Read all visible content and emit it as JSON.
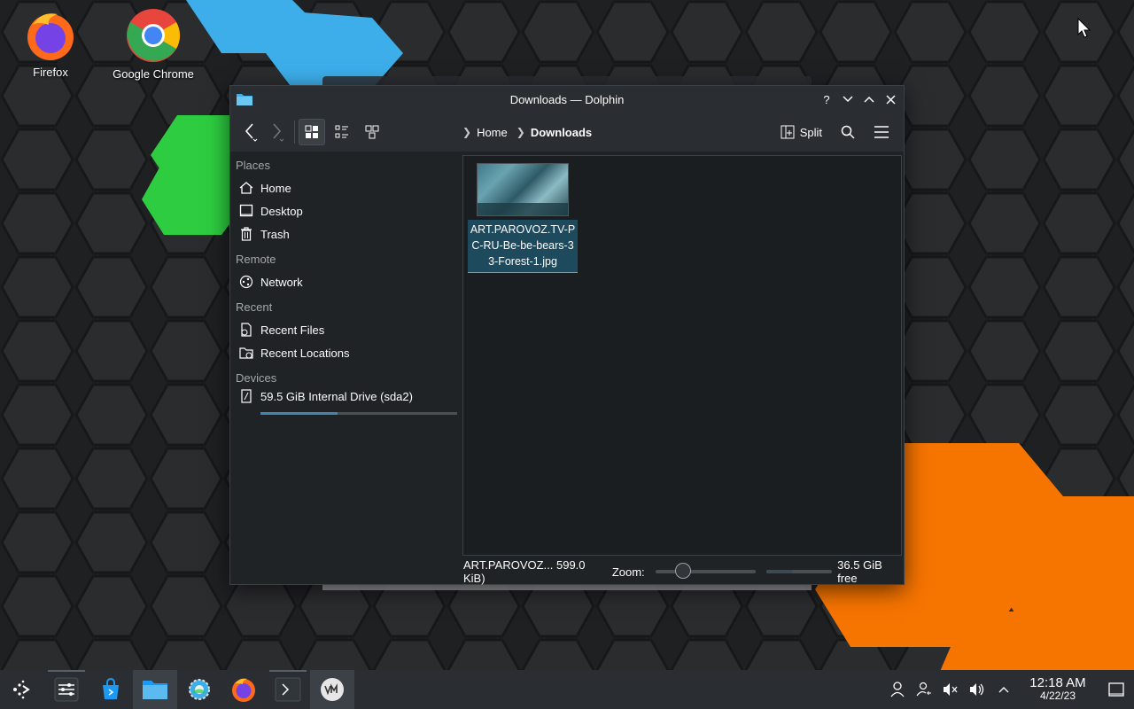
{
  "desktop": {
    "icons": [
      {
        "label": "Firefox",
        "icon": "firefox-icon"
      },
      {
        "label": "Google Chrome",
        "icon": "chrome-icon"
      }
    ]
  },
  "window": {
    "title": "Downloads — Dolphin",
    "app_icon": "folder-icon"
  },
  "toolbar": {
    "back_icon": "chevron-left-icon",
    "forward_icon": "chevron-right-icon",
    "view_modes": [
      "icons",
      "compact",
      "details"
    ],
    "active_view_mode": "icons",
    "breadcrumb": [
      "Home",
      "Downloads"
    ],
    "split_label": "Split"
  },
  "places": {
    "sections": [
      {
        "title": "Places",
        "items": [
          {
            "label": "Home",
            "icon": "home-icon"
          },
          {
            "label": "Desktop",
            "icon": "desktop-icon"
          },
          {
            "label": "Trash",
            "icon": "trash-icon"
          }
        ]
      },
      {
        "title": "Remote",
        "items": [
          {
            "label": "Network",
            "icon": "network-icon"
          }
        ]
      },
      {
        "title": "Recent",
        "items": [
          {
            "label": "Recent Files",
            "icon": "recent-files-icon"
          },
          {
            "label": "Recent Locations",
            "icon": "recent-locations-icon"
          }
        ]
      },
      {
        "title": "Devices",
        "items": [
          {
            "label": "59.5 GiB Internal Drive (sda2)",
            "icon": "drive-icon",
            "usage_fraction": 0.39
          }
        ]
      }
    ]
  },
  "files": [
    {
      "name": "ART.PAROVOZ.TV-PC-RU-Be-be-bears-33-Forest-1.jpg",
      "selected": true
    }
  ],
  "statusbar": {
    "selection_info": "ART.PAROVOZ... 599.0 KiB)",
    "zoom_label": "Zoom:",
    "free_space": "36.5 GiB free",
    "free_fraction": 0.61
  },
  "taskbar": {
    "items": [
      "application-launcher-icon",
      "system-settings-icon",
      "discover-store-icon",
      "dolphin-icon",
      "settings-gear-icon",
      "firefox-icon",
      "konsole-icon",
      "vm-icon"
    ],
    "active": "dolphin-icon",
    "tray": [
      "user-icon",
      "user-switch-icon",
      "audio-muted-icon",
      "volume-icon",
      "tray-expand-icon"
    ],
    "time": "12:18 AM",
    "date": "4/22/23",
    "show_desktop_icon": "show-desktop-icon"
  },
  "colors": {
    "accent": "#3daee9",
    "window_bg": "#202326",
    "taskbar_bg": "#2a2e32",
    "wallpaper_blue": "#3daee9",
    "wallpaper_green": "#2ecc40",
    "wallpaper_orange": "#f67400"
  }
}
